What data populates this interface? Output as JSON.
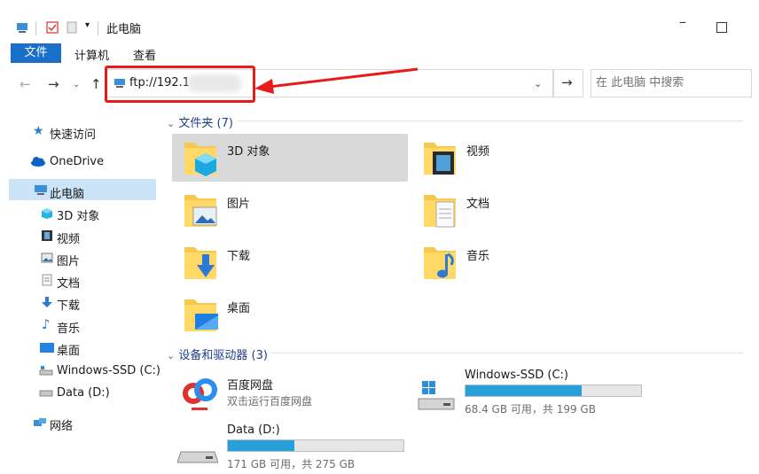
{
  "window": {
    "title": "此电脑"
  },
  "ribbon": {
    "tabs": [
      "文件",
      "计算机",
      "查看"
    ]
  },
  "address": {
    "path": "ftp://192.1",
    "search_placeholder": "在 此电脑 中搜索"
  },
  "sidebar": {
    "items": [
      {
        "label": "快速访问",
        "icon": "star-icon"
      },
      {
        "label": "OneDrive",
        "icon": "cloud-icon"
      },
      {
        "label": "此电脑",
        "icon": "computer-icon",
        "selected": true
      },
      {
        "label": "3D 对象",
        "icon": "cube-icon"
      },
      {
        "label": "视频",
        "icon": "film-icon"
      },
      {
        "label": "图片",
        "icon": "picture-icon"
      },
      {
        "label": "文档",
        "icon": "document-icon"
      },
      {
        "label": "下载",
        "icon": "download-icon"
      },
      {
        "label": "音乐",
        "icon": "music-icon"
      },
      {
        "label": "桌面",
        "icon": "desktop-icon"
      },
      {
        "label": "Windows-SSD (C:)",
        "icon": "drive-icon"
      },
      {
        "label": "Data (D:)",
        "icon": "drive-icon"
      },
      {
        "label": "网络",
        "icon": "network-icon"
      }
    ]
  },
  "folders_group": {
    "header": "文件夹 (7)"
  },
  "folders": [
    {
      "label": "3D 对象",
      "icon": "cube-icon"
    },
    {
      "label": "视频",
      "icon": "film-icon"
    },
    {
      "label": "图片",
      "icon": "picture-icon"
    },
    {
      "label": "文档",
      "icon": "document-icon"
    },
    {
      "label": "下载",
      "icon": "download-icon"
    },
    {
      "label": "音乐",
      "icon": "music-icon"
    },
    {
      "label": "桌面",
      "icon": "desktop-icon"
    }
  ],
  "drives_group": {
    "header": "设备和驱动器 (3)"
  },
  "drives": [
    {
      "name": "百度网盘",
      "sub": "双击运行百度网盘"
    },
    {
      "name": "Windows-SSD (C:)",
      "free": "68.4 GB 可用，共 199 GB",
      "used_fraction": 0.66
    },
    {
      "name": "Data (D:)",
      "free": "171 GB 可用，共 275 GB",
      "used_fraction": 0.38
    }
  ],
  "colors": {
    "accent": "#1a6fc8",
    "selection": "#cce4f7",
    "annotation": "#e81b1b",
    "drive_bar": "#26a0da"
  }
}
